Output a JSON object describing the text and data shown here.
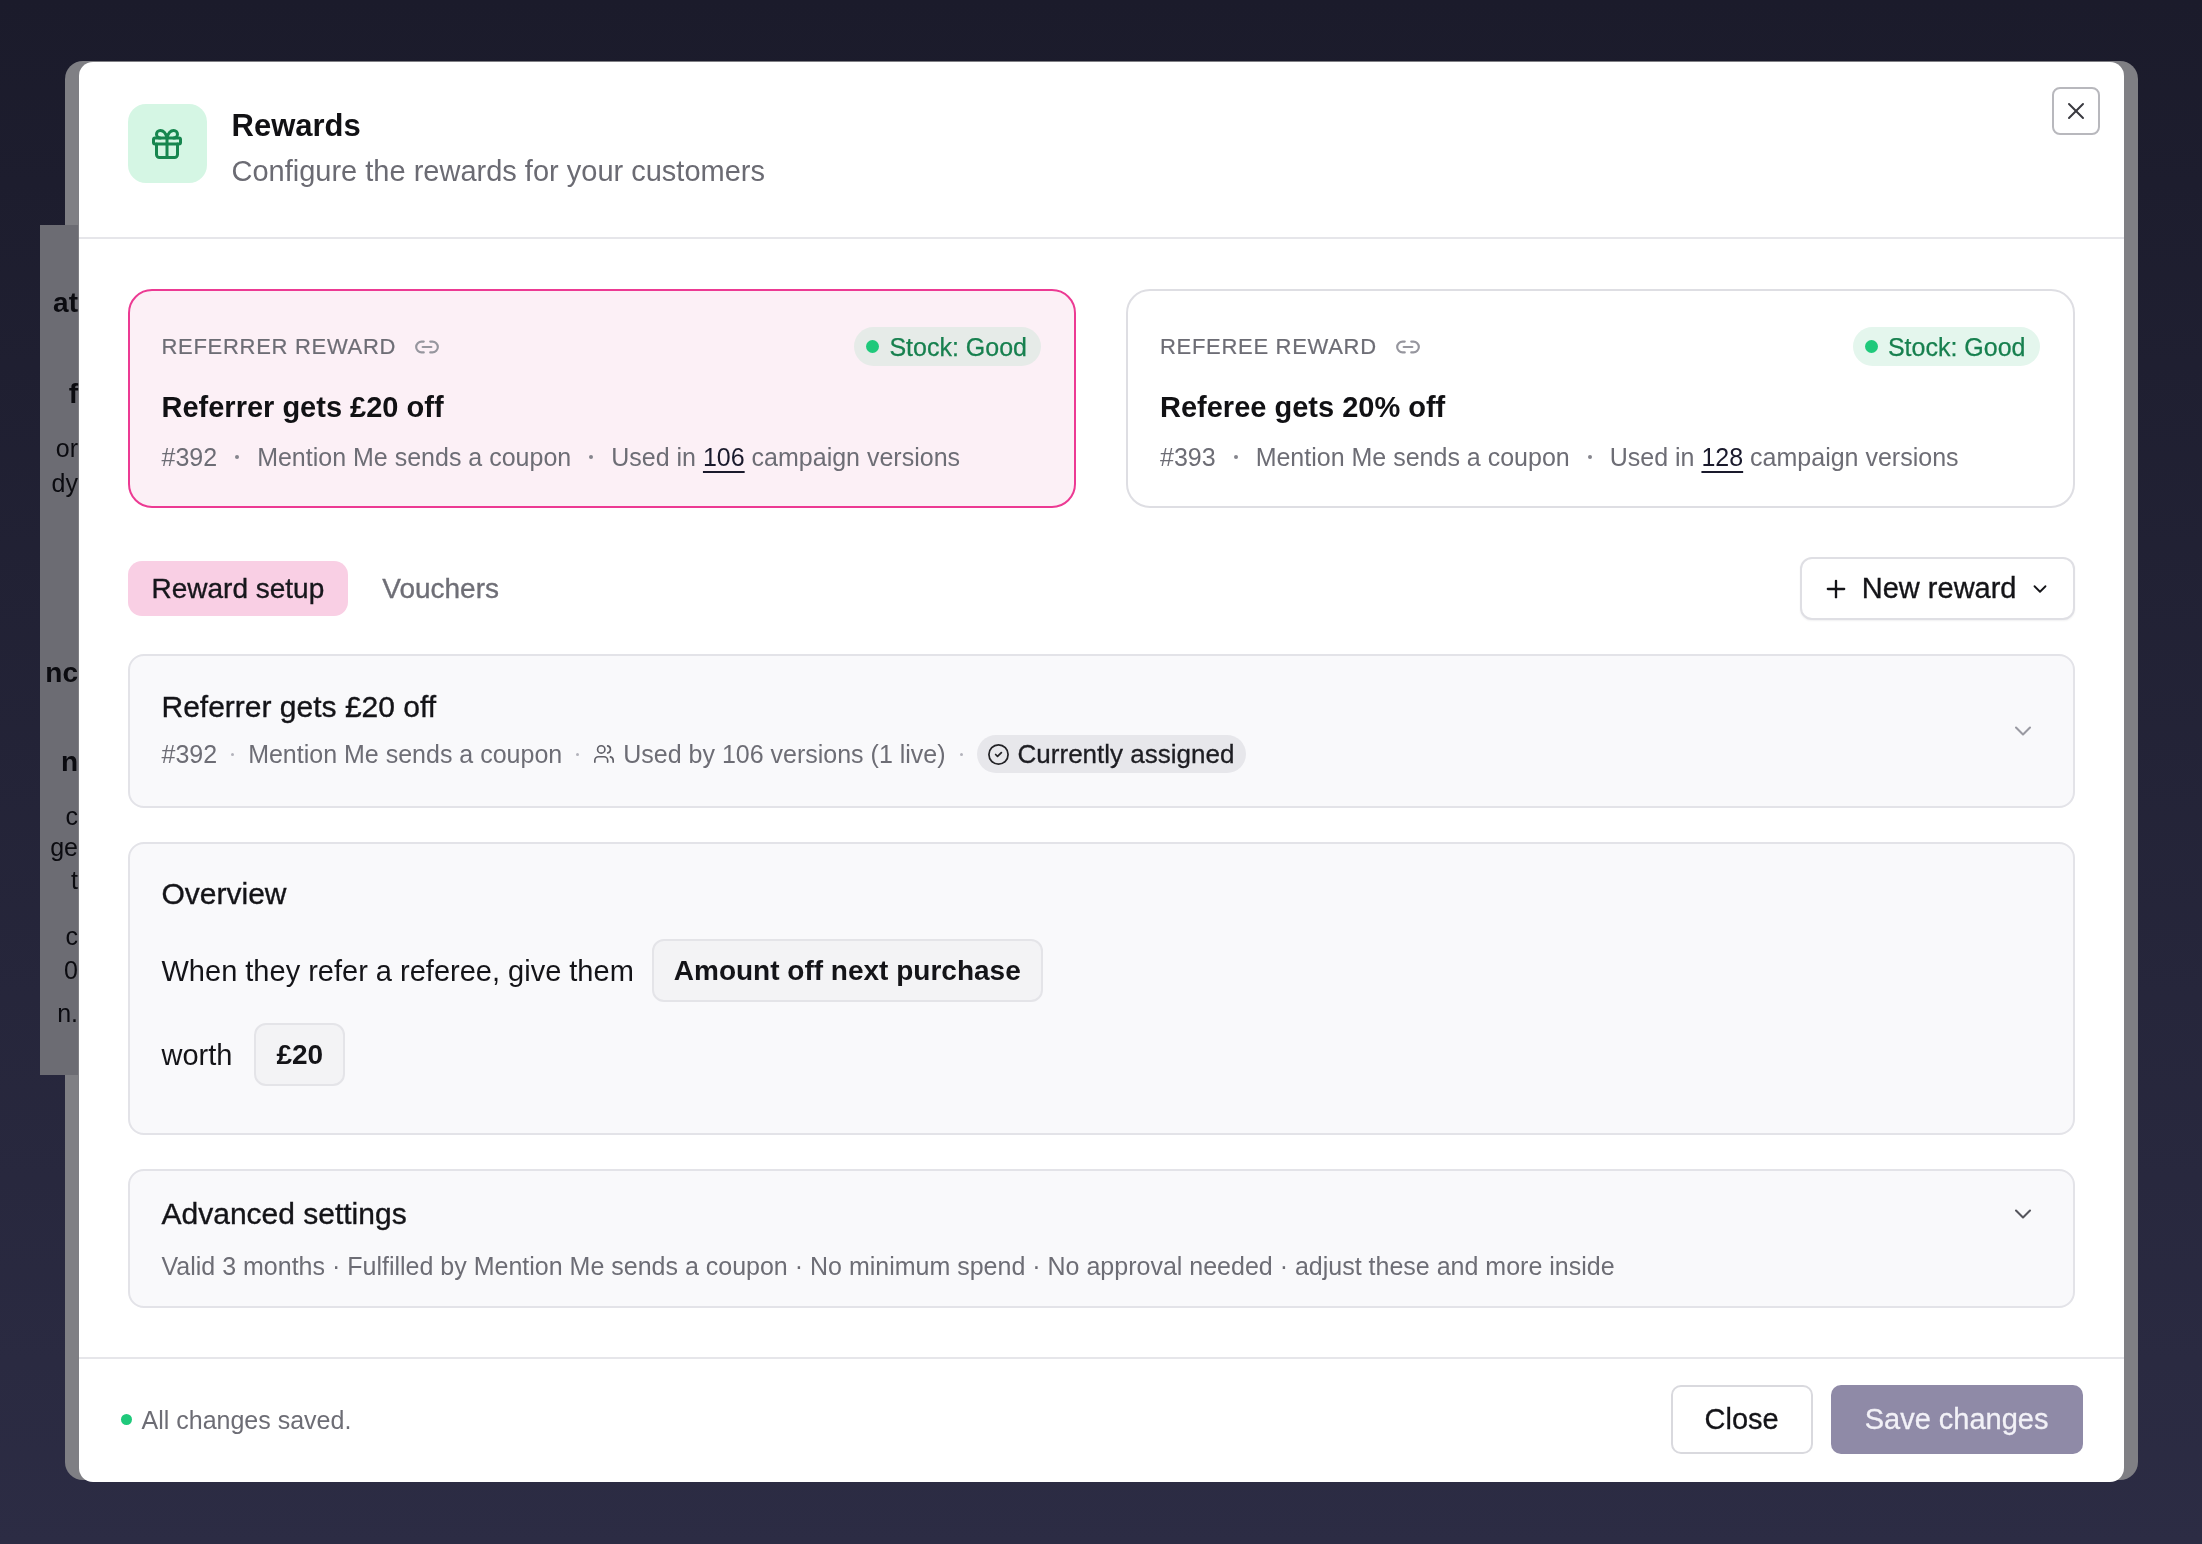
{
  "background_page": {
    "fragments": [
      {
        "kind": "heading",
        "text": "at"
      },
      {
        "kind": "heading",
        "text": "f"
      },
      {
        "kind": "text",
        "text": "or"
      },
      {
        "kind": "text",
        "text": "dy"
      },
      {
        "kind": "heading",
        "text": "nc"
      },
      {
        "kind": "heading",
        "text": "n"
      },
      {
        "kind": "text",
        "text": "c"
      },
      {
        "kind": "text",
        "text": "ge"
      },
      {
        "kind": "text",
        "text": "t"
      },
      {
        "kind": "text",
        "text": "c"
      },
      {
        "kind": "text",
        "text": "0"
      },
      {
        "kind": "text",
        "text": "n."
      }
    ]
  },
  "dialog": {
    "title": "Rewards",
    "subtitle": "Configure the rewards for your customers"
  },
  "reward_cards": [
    {
      "label": "REFERRER REWARD",
      "stock": "Stock: Good",
      "title": "Referrer gets £20 off",
      "id": "#392",
      "fulfilment": "Mention Me sends a coupon",
      "usage": {
        "before": "Used in",
        "link": "106",
        "after": "campaign versions"
      },
      "selected": true
    },
    {
      "label": "REFEREE REWARD",
      "stock": "Stock: Good",
      "title": "Referee gets 20% off",
      "id": "#393",
      "fulfilment": "Mention Me sends a coupon",
      "usage": {
        "before": "Used in",
        "link": "128",
        "after": "campaign versions"
      },
      "selected": false
    }
  ],
  "tabs": [
    {
      "label": "Reward setup",
      "selected": true
    },
    {
      "label": "Vouchers",
      "selected": false
    }
  ],
  "new_reward_button": {
    "label": "New reward"
  },
  "reward_row": {
    "title": "Referrer gets £20 off",
    "id": "#392",
    "fulfilment": "Mention Me sends a coupon",
    "usage": "Used by 106 versions (1 live)",
    "badge": "Currently assigned",
    "expanded": false
  },
  "overview": {
    "title": "Overview",
    "lines": [
      [
        {
          "kind": "text",
          "text": "When they refer a referee, give them"
        },
        {
          "kind": "select",
          "value": "Amount off next purchase"
        }
      ],
      [
        {
          "kind": "text",
          "text": "worth"
        },
        {
          "kind": "field",
          "value": "£20"
        }
      ]
    ]
  },
  "advanced_settings": {
    "title": "Advanced settings",
    "summary": "Valid 3 months · Fulfilled by Mention Me sends a coupon · No minimum spend · No approval needed · adjust these and more inside",
    "expanded": false
  },
  "footer": {
    "status": "All changes saved.",
    "buttons": [
      {
        "label": "Close",
        "kind": "secondary",
        "disabled": false
      },
      {
        "label": "Save changes",
        "kind": "primary",
        "disabled": true
      }
    ]
  }
}
